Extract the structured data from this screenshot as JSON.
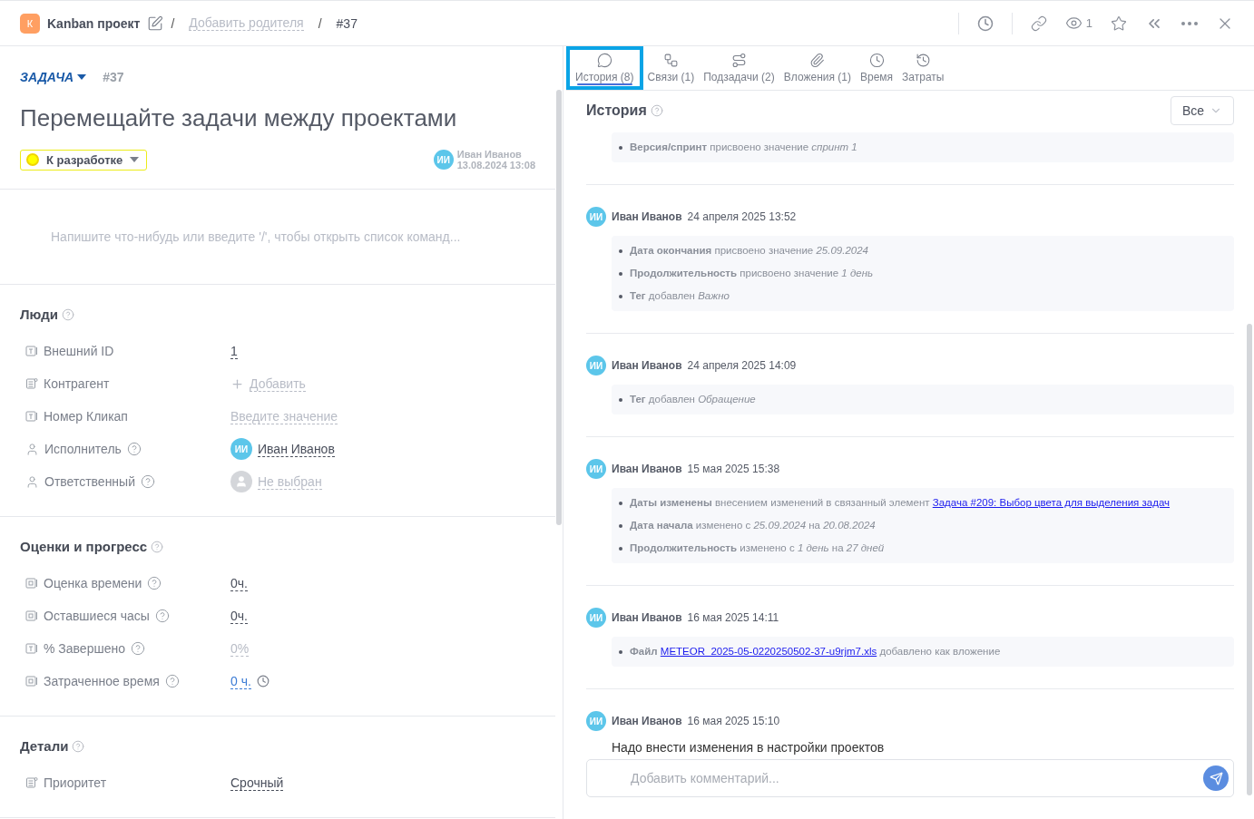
{
  "header": {
    "logo": "К",
    "project": "Kanban проект",
    "separator": "/",
    "parent": "Добавить родителя",
    "number": "#37",
    "watchers": "1"
  },
  "task": {
    "type": "ЗАДАЧА",
    "number": "#37",
    "title": "Перемещайте задачи между проектами",
    "status": "К разработке",
    "creator": {
      "avatar": "ИИ",
      "name": "Иван Иванов",
      "date": "13.08.2024 13:08"
    },
    "editor_placeholder": "Напишите что-нибудь или введите '/', чтобы открыть список команд..."
  },
  "sections": [
    {
      "title": "Люди",
      "fields": [
        {
          "kind": "text",
          "label": "Внешний ID",
          "help": false,
          "value": {
            "kind": "plain",
            "text": "1"
          }
        },
        {
          "kind": "list",
          "label": "Контрагент",
          "help": false,
          "value": {
            "kind": "add",
            "text": "Добавить"
          }
        },
        {
          "kind": "text",
          "label": "Номер Кликап",
          "help": false,
          "value": {
            "kind": "muted",
            "text": "Введите значение"
          }
        },
        {
          "kind": "person",
          "label": "Исполнитель",
          "help": true,
          "value": {
            "kind": "user",
            "avatar": "ИИ",
            "text": "Иван Иванов"
          }
        },
        {
          "kind": "person",
          "label": "Ответственный",
          "help": true,
          "value": {
            "kind": "nouser",
            "text": "Не выбран"
          }
        }
      ]
    },
    {
      "title": "Оценки и прогресс",
      "fields": [
        {
          "kind": "number",
          "label": "Оценка времени",
          "help": true,
          "value": {
            "kind": "plain",
            "text": "0ч."
          }
        },
        {
          "kind": "number",
          "label": "Оставшиеся часы",
          "help": true,
          "value": {
            "kind": "plain",
            "text": "0ч."
          }
        },
        {
          "kind": "text",
          "label": "% Завершено",
          "help": true,
          "value": {
            "kind": "muted",
            "text": "0%"
          }
        },
        {
          "kind": "number",
          "label": "Затраченное время",
          "help": true,
          "value": {
            "kind": "timer",
            "text": "0 ч."
          }
        }
      ]
    },
    {
      "title": "Детали",
      "fields": [
        {
          "kind": "list",
          "label": "Приоритет",
          "help": false,
          "value": {
            "kind": "plain",
            "text": "Срочный"
          }
        }
      ]
    }
  ],
  "tabs": [
    {
      "kind": "history",
      "label": "История (8)",
      "selected": true
    },
    {
      "kind": "links",
      "label": "Связи (1)",
      "selected": false
    },
    {
      "kind": "subtasks",
      "label": "Подзадачи (2)",
      "selected": false
    },
    {
      "kind": "attachments",
      "label": "Вложения (1)",
      "selected": false
    },
    {
      "kind": "time",
      "label": "Время",
      "selected": false
    },
    {
      "kind": "costs",
      "label": "Затраты",
      "selected": false
    }
  ],
  "history": {
    "title": "История",
    "filter": "Все",
    "entries": [
      {
        "items": [
          {
            "text": "**Версия/спринт** присвоено значение *спринт 1*"
          }
        ]
      },
      {
        "avatar": "ИИ",
        "author": "Иван Иванов",
        "date": "24 апреля 2025 13:52",
        "items": [
          {
            "text": "**Дата окончания** присвоено значение *25.09.2024*"
          },
          {
            "text": "**Продолжительность** присвоено значение *1 день*"
          },
          {
            "text": "**Тег** добавлен *Важно*"
          }
        ]
      },
      {
        "avatar": "ИИ",
        "author": "Иван Иванов",
        "date": "24 апреля 2025 14:09",
        "items": [
          {
            "text": "**Тег** добавлен *Обращение*"
          }
        ]
      },
      {
        "avatar": "ИИ",
        "author": "Иван Иванов",
        "date": "15 мая 2025 15:38",
        "items": [
          {
            "text": "**Даты изменены** внесением изменений в связанный элемент",
            "link": "Задача #209: Выбор цвета для выделения задач"
          },
          {
            "text": "**Дата начала** изменено с *25.09.2024* на *20.08.2024*"
          },
          {
            "text": "**Продолжительность** изменено с *1 день* на *27 дней*"
          }
        ]
      },
      {
        "avatar": "ИИ",
        "author": "Иван Иванов",
        "date": "16 мая 2025 14:11",
        "items": [
          {
            "text": "**Файл**",
            "link": "METEOR_2025-05-0220250502-37-u9rjm7.xls",
            "after": "добавлено как вложение"
          }
        ]
      },
      {
        "avatar": "ИИ",
        "author": "Иван Иванов",
        "date": "16 мая 2025 15:10",
        "comment": "Надо внести изменения в настройки проектов"
      }
    ]
  },
  "comment": {
    "placeholder": "Добавить комментарий..."
  }
}
